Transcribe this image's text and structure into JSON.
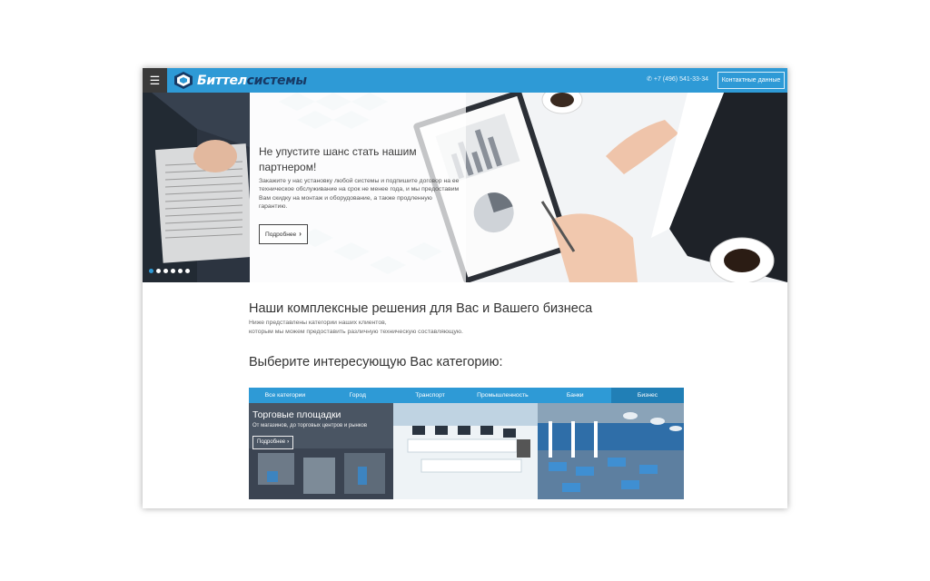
{
  "header": {
    "menu_icon": "hamburger-icon",
    "logo_part1": "Биттел",
    "logo_part2": "системы",
    "phone_icon": "phone-icon",
    "phone": "+7 (496) 541-33-34",
    "contacts_button": "Контактные данные"
  },
  "hero": {
    "title": "Не упустите шанс стать нашим партнером!",
    "text": "Закажите у нас установку любой системы и подпишите договор на ее техническое обслуживание на срок не менее года, и мы предоставим Вам скидку на монтаж и оборудование, а также продленную гарантию.",
    "more_button": "Подробнее",
    "slides_total": 6,
    "slide_active": 1
  },
  "solutions": {
    "title": "Наши комплексные решения для Вас и Вашего бизнеса",
    "subtitle_line1": "Ниже представлены категории наших клиентов,",
    "subtitle_line2": "которым мы можем предоставить различную техническую составляющую."
  },
  "categories": {
    "title": "Выберите интересующую Вас категорию:",
    "tabs": [
      "Все категории",
      "Город",
      "Транспорт",
      "Промышленность",
      "Банки",
      "Бизнес"
    ],
    "active_tab": "Бизнес",
    "panel_title": "Торговые площадки",
    "panel_text": "От магазинов, до торговых центров и рынков",
    "panel_button": "Подробнее"
  },
  "colors": {
    "accent": "#2e9ad6",
    "accent_dark": "#217fb6",
    "menu_bg": "#3a3a3a",
    "logo_dark": "#173a66"
  }
}
